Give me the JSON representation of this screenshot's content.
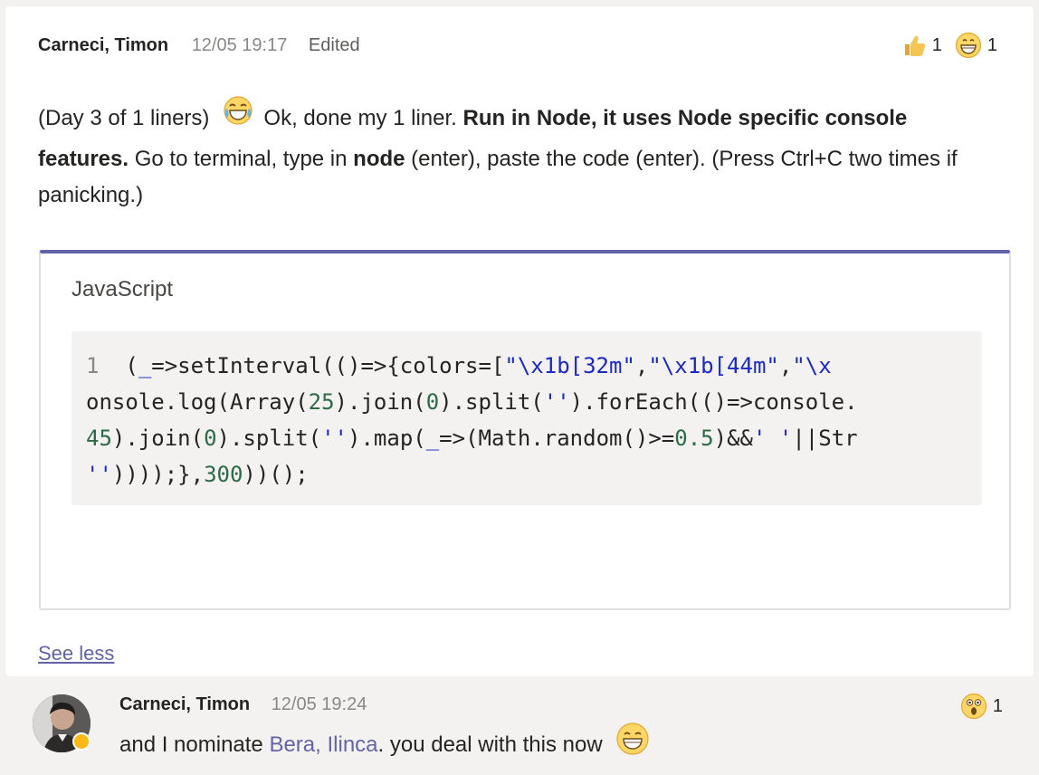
{
  "message": {
    "author": "Carneci, Timon",
    "time": "12/05 19:17",
    "edited_label": "Edited",
    "reactions": [
      {
        "icon": "thumbs-up-icon",
        "count": "1"
      },
      {
        "icon": "grinning-face-icon",
        "count": "1"
      }
    ],
    "text": {
      "p1": "(Day 3 of 1 liners)",
      "p2": "Ok, done my 1 liner. ",
      "bold1": "Run in Node, it uses Node specific console features.",
      "p3": " Go to terminal, type in ",
      "bold2": "node",
      "p4": " (enter), paste the code (enter). (Press Ctrl+C two times if panicking.)"
    },
    "code": {
      "language": "JavaScript",
      "line_number": "1",
      "line1_a": "(",
      "line1_b": "_",
      "line1_c": "=>setInterval(()=>{colors=[",
      "line1_d": "\"\\x1b[32m\"",
      "line1_e": ",",
      "line1_f": "\"\\x1b[44m\"",
      "line1_g": ",",
      "line1_h": "\"\\x",
      "line2_a": "onsole.log(Array(",
      "line2_b": "25",
      "line2_c": ").join(",
      "line2_d": "0",
      "line2_e": ").split(",
      "line2_f": "''",
      "line2_g": ").forEach(()=>console.",
      "line3_a": "45",
      "line3_b": ").join(",
      "line3_c": "0",
      "line3_d": ").split(",
      "line3_e": "''",
      "line3_f": ").map(",
      "line3_g": "_",
      "line3_h": "=>(Math.random()>=",
      "line3_i": "0.5",
      "line3_j": ")&&",
      "line3_k": "' '",
      "line3_l": "||Str",
      "line4_a": "''",
      "line4_b": "))));},",
      "line4_c": "300",
      "line4_d": "))();"
    },
    "see_less_label": "See less"
  },
  "reply": {
    "author": "Carneci, Timon",
    "time": "12/05 19:24",
    "text_before": "and I nominate ",
    "mention": "Bera, Ilinca",
    "text_after": ". you deal with this now",
    "reaction": {
      "icon": "astonished-face-icon",
      "count": "1"
    }
  },
  "colors": {
    "accent": "#6264a7",
    "code_string": "#1a29c8",
    "code_number": "#2b6b45",
    "presence_away": "#fdb913"
  }
}
